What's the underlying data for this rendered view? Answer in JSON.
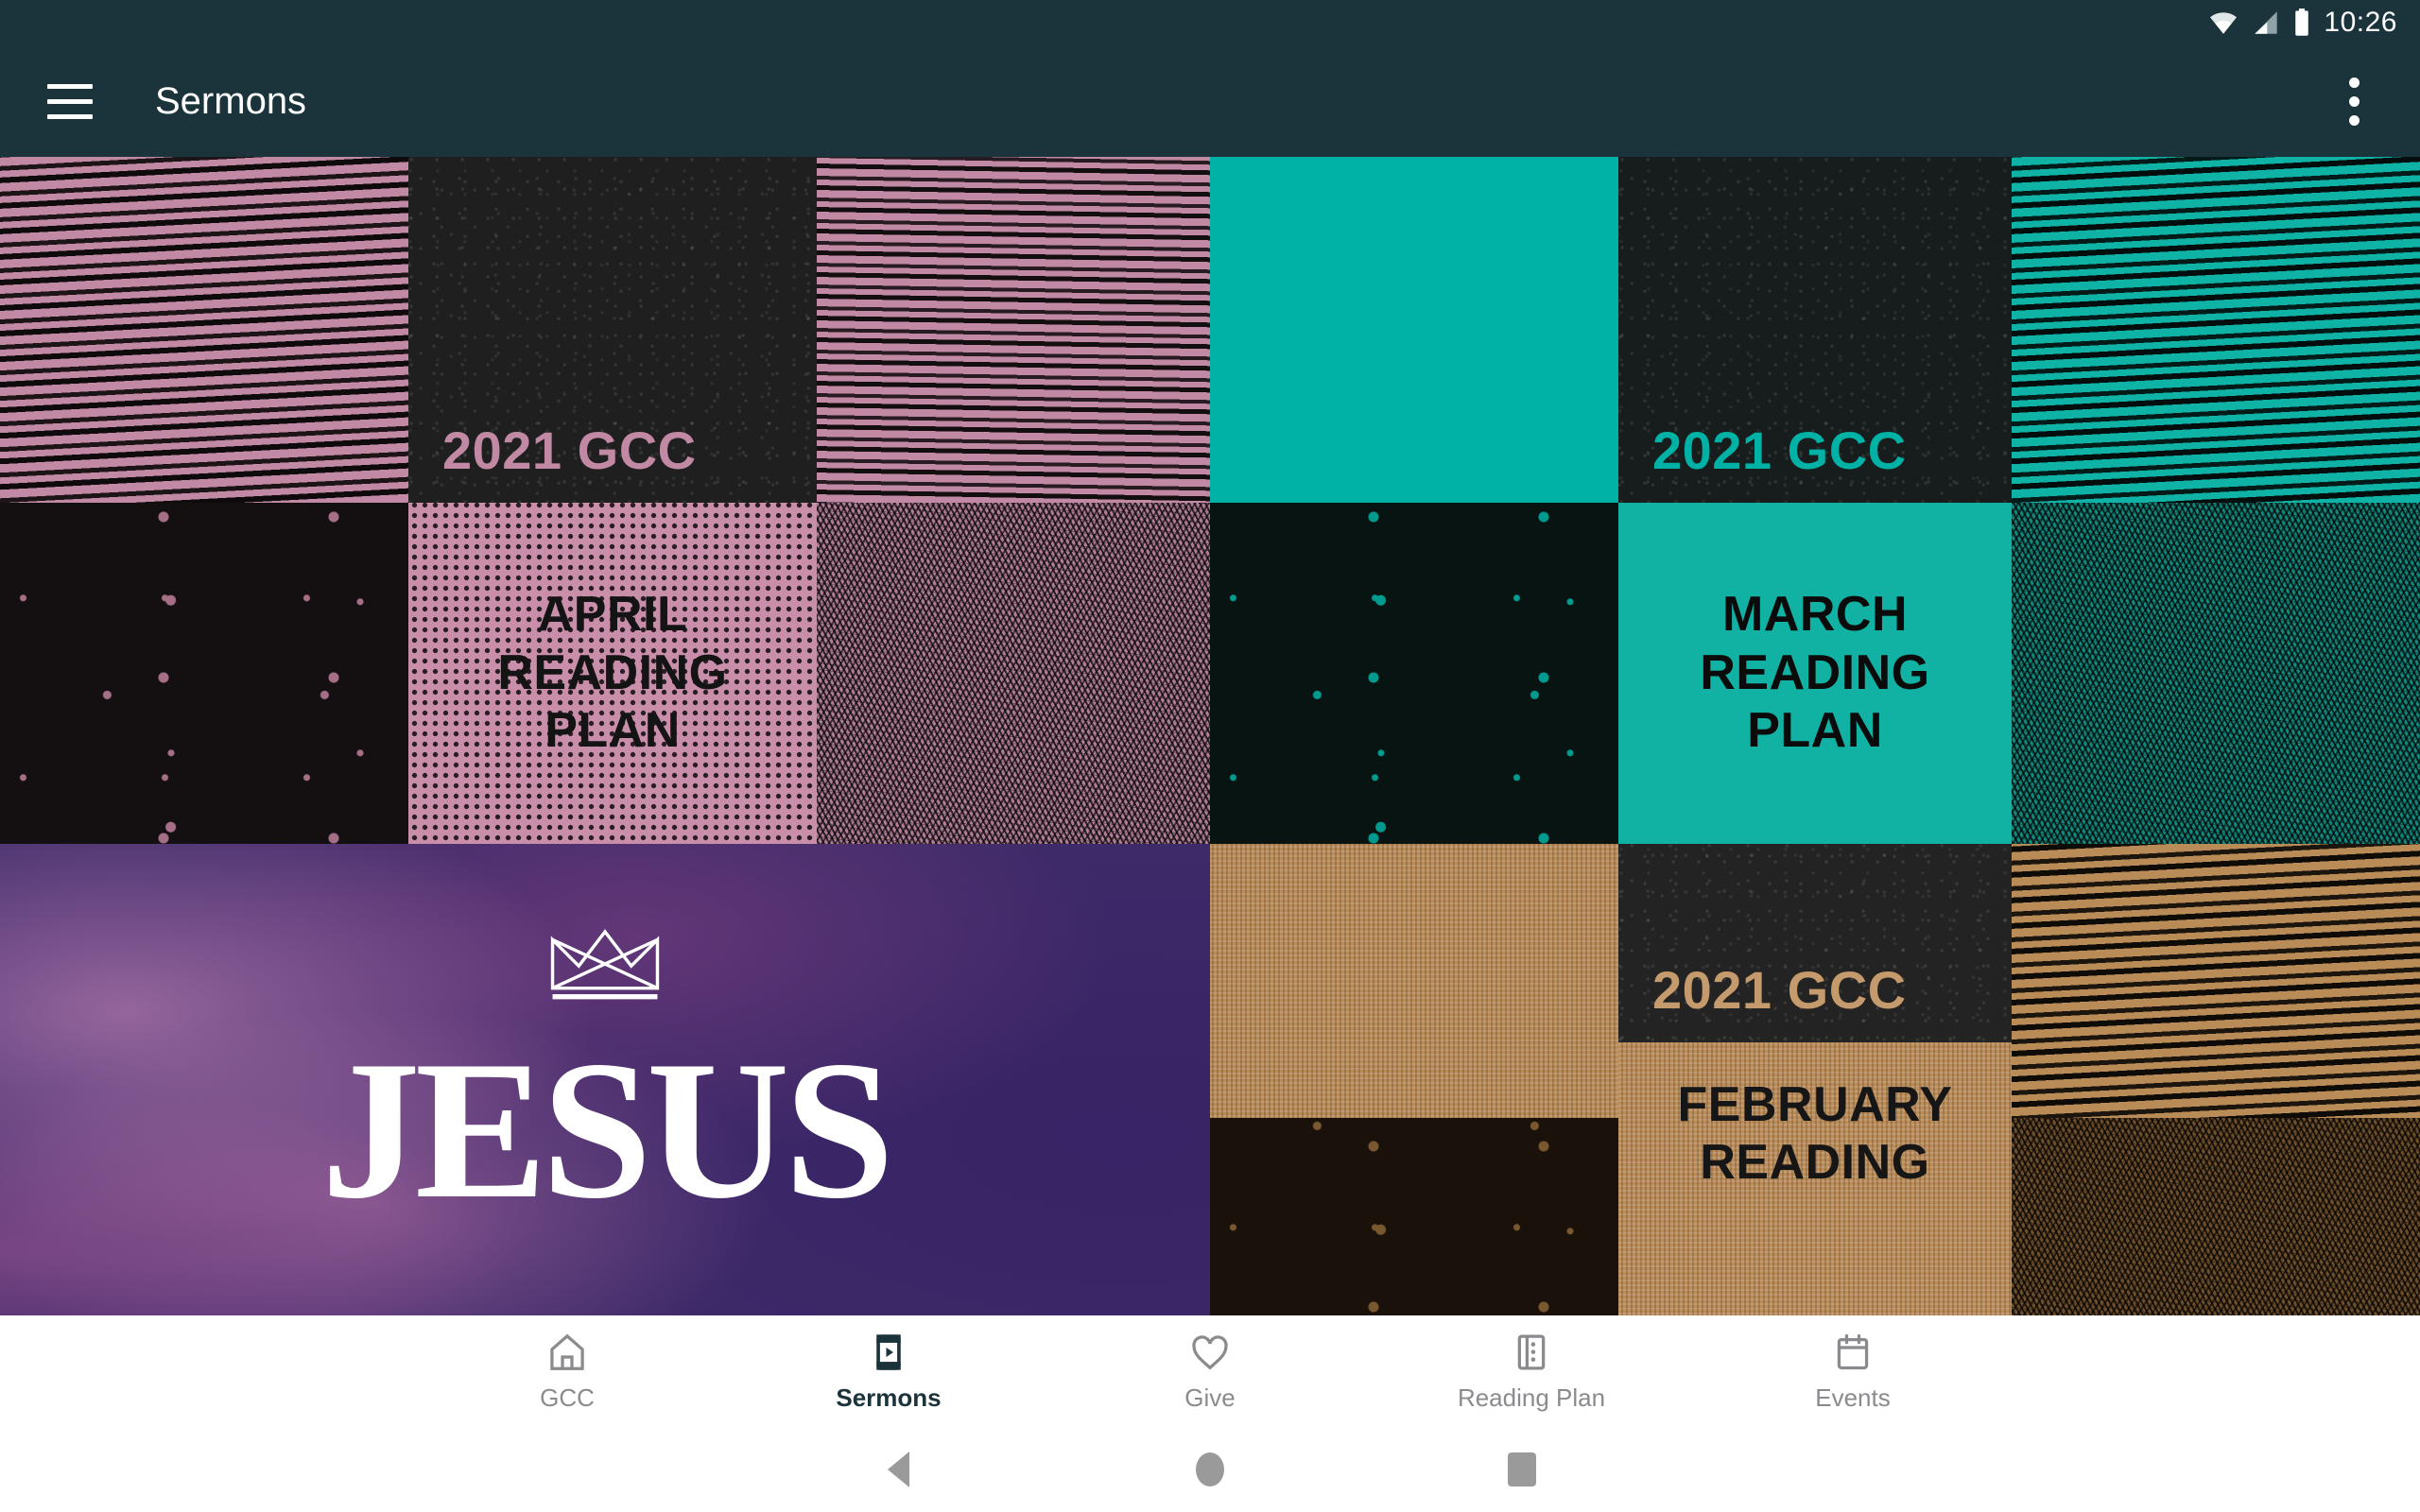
{
  "status_bar": {
    "time": "10:26",
    "icons": [
      "wifi-icon",
      "cell-signal-icon",
      "battery-icon"
    ]
  },
  "app_bar": {
    "menu_icon": "hamburger-menu-icon",
    "title": "Sermons",
    "overflow_icon": "more-vert-icon",
    "background": "#1b333b"
  },
  "grid": {
    "tiles": [
      {
        "name": "tile-pink-lines",
        "label": "",
        "bg": "#c289a4",
        "fg": "#1a1a1a",
        "texture": "tx-lines"
      },
      {
        "name": "tile-2021-gcc-pink",
        "label": "2021 GCC",
        "bg": "#1f1f1f",
        "fg": "#c289a4",
        "texture": "tx-grain"
      },
      {
        "name": "tile-pink-lines-2",
        "label": "",
        "bg": "#c289a4",
        "fg": "#1a1a1a",
        "texture": "tx-lines2"
      },
      {
        "name": "tile-teal-solid",
        "label": "",
        "bg": "#00b2a5",
        "fg": "#0d0d0d",
        "texture": ""
      },
      {
        "name": "tile-2021-gcc-teal",
        "label": "2021 GCC",
        "bg": "#161d1c",
        "fg": "#00b2a5",
        "texture": "tx-grain"
      },
      {
        "name": "tile-teal-lines",
        "label": "",
        "bg": "#0fb3a6",
        "fg": "#0d0d0d",
        "texture": "tx-lines"
      },
      {
        "name": "tile-dark-pink-specks",
        "label": "",
        "bg": "#141012",
        "fg": "#c07f9c",
        "texture": "tx-specks"
      },
      {
        "name": "tile-april-reading-plan",
        "label": "APRIL\nREADING\nPLAN",
        "bg": "#c98faa",
        "fg": "#141414",
        "texture": "tx-halftone"
      },
      {
        "name": "tile-pink-hatch",
        "label": "",
        "bg": "#b07c96",
        "fg": "#141414",
        "texture": "tx-hatch"
      },
      {
        "name": "tile-dark-teal-specks",
        "label": "",
        "bg": "#071412",
        "fg": "#00b2a5",
        "texture": "tx-specks"
      },
      {
        "name": "tile-march-reading-plan",
        "label": "MARCH\nREADING\nPLAN",
        "bg": "#11b2a4",
        "fg": "#0b0b0b",
        "texture": ""
      },
      {
        "name": "tile-teal-hatch",
        "label": "",
        "bg": "#12897f",
        "fg": "#0b0b0b",
        "texture": "tx-hatch"
      },
      {
        "name": "tile-jesus",
        "label": "JESUS",
        "bg": "#3d2a68",
        "fg": "#ffffff",
        "texture": "tx-cloud"
      },
      {
        "name": "tile-tan-weave",
        "label": "",
        "bg": "#b98b57",
        "fg": "#141414",
        "texture": "tx-weave"
      },
      {
        "name": "tile-2021-gcc-tan",
        "label": "2021 GCC",
        "bg": "#232323",
        "fg": "#c59a6c",
        "texture": "tx-grain"
      },
      {
        "name": "tile-tan-lines",
        "label": "",
        "bg": "#b98b57",
        "fg": "#141414",
        "texture": "tx-lines"
      },
      {
        "name": "tile-dark-tan-specks",
        "label": "",
        "bg": "#1a120a",
        "fg": "#8a6436",
        "texture": "tx-specks"
      },
      {
        "name": "tile-february-reading",
        "label": "FEBRUARY\nREADING",
        "bg": "#bb8c58",
        "fg": "#161616",
        "texture": "tx-weave"
      },
      {
        "name": "tile-tan-hatch",
        "label": "",
        "bg": "#6e4f2c",
        "fg": "#141414",
        "texture": "tx-hatch"
      }
    ],
    "jesus_crown_icon": "crown-icon"
  },
  "bottom_nav": {
    "items": [
      {
        "label": "GCC",
        "icon": "home-icon",
        "active": false
      },
      {
        "label": "Sermons",
        "icon": "video-play-icon",
        "active": true
      },
      {
        "label": "Give",
        "icon": "heart-icon",
        "active": false
      },
      {
        "label": "Reading Plan",
        "icon": "book-icon",
        "active": false
      },
      {
        "label": "Events",
        "icon": "calendar-icon",
        "active": false
      }
    ],
    "active_color": "#1b333b",
    "inactive_color": "#8b8b8f"
  },
  "system_nav": {
    "back": "back-triangle-icon",
    "home": "home-circle-icon",
    "recent": "recent-square-icon"
  }
}
